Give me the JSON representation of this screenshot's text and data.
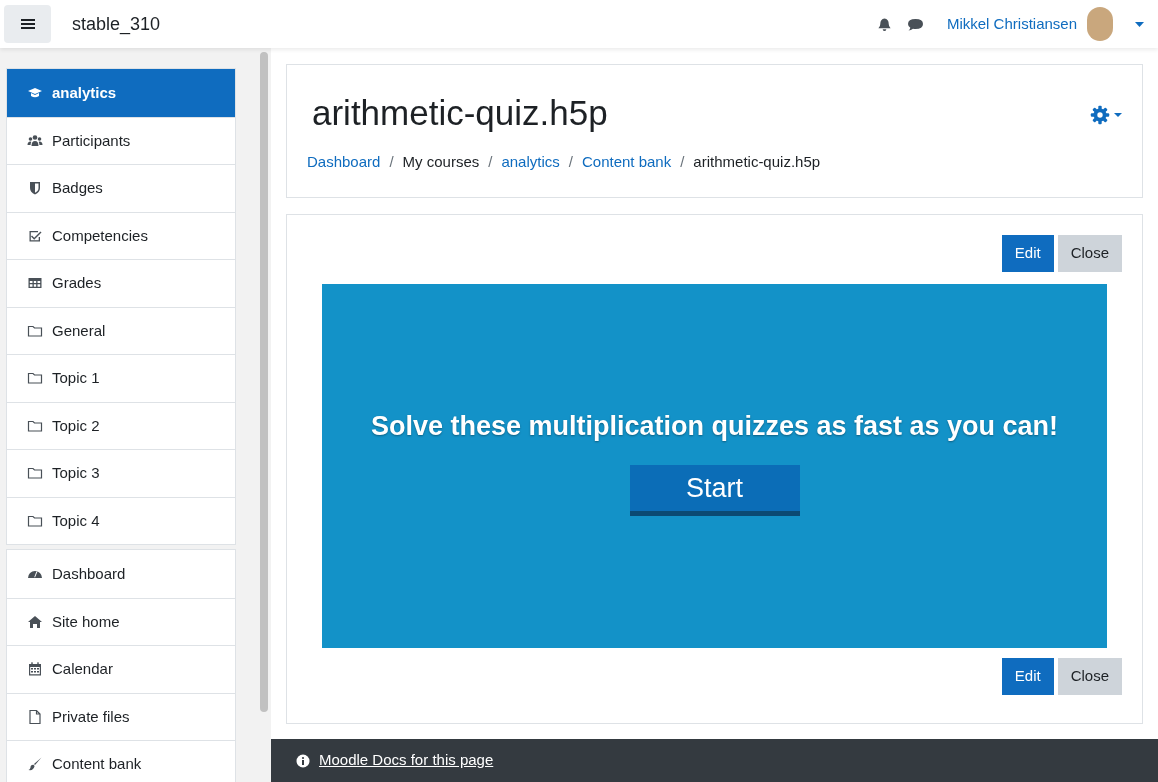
{
  "navbar": {
    "site_name": "stable_310",
    "user_name": "Mikkel Christiansen"
  },
  "sidebar": {
    "groups": [
      [
        {
          "label": "analytics",
          "kind": "cap",
          "selected": true
        },
        {
          "label": "Participants",
          "kind": "users",
          "selected": false
        },
        {
          "label": "Badges",
          "kind": "shield",
          "selected": false
        },
        {
          "label": "Competencies",
          "kind": "check",
          "selected": false
        },
        {
          "label": "Grades",
          "kind": "table",
          "selected": false
        },
        {
          "label": "General",
          "kind": "folder",
          "selected": false
        },
        {
          "label": "Topic 1",
          "kind": "folder",
          "selected": false
        },
        {
          "label": "Topic 2",
          "kind": "folder",
          "selected": false
        },
        {
          "label": "Topic 3",
          "kind": "folder",
          "selected": false
        },
        {
          "label": "Topic 4",
          "kind": "folder",
          "selected": false
        }
      ],
      [
        {
          "label": "Dashboard",
          "kind": "gauge",
          "selected": false
        },
        {
          "label": "Site home",
          "kind": "home",
          "selected": false
        },
        {
          "label": "Calendar",
          "kind": "calendar",
          "selected": false
        },
        {
          "label": "Private files",
          "kind": "file",
          "selected": false
        },
        {
          "label": "Content bank",
          "kind": "brush",
          "selected": false
        }
      ]
    ]
  },
  "header": {
    "title": "arithmetic-quiz.h5p",
    "breadcrumb": [
      {
        "label": "Dashboard",
        "link": true
      },
      {
        "separator": "/",
        "label": "My courses",
        "link": false
      },
      {
        "separator": "/",
        "label": "analytics",
        "link": true
      },
      {
        "separator": "/",
        "label": "Content bank",
        "link": true
      },
      {
        "separator": "/",
        "label": "arithmetic-quiz.h5p",
        "link": false
      }
    ]
  },
  "content": {
    "top_buttons": [
      {
        "label": "Edit",
        "kind": "primary"
      },
      {
        "label": "Close",
        "kind": "secondary"
      }
    ],
    "quiz": {
      "intro": "Solve these multiplication quizzes as fast as you can!",
      "start_button": "Start"
    },
    "bottom_buttons": [
      {
        "label": "Edit",
        "kind": "primary"
      },
      {
        "label": "Close",
        "kind": "secondary"
      }
    ]
  },
  "footer": {
    "docs_link": "Moodle Docs for this page"
  }
}
